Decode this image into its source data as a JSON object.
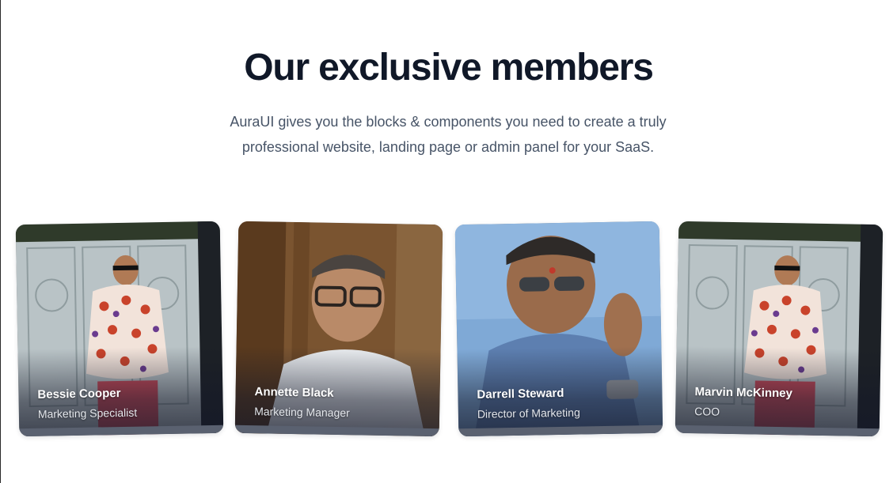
{
  "header": {
    "title": "Our exclusive members",
    "subtitle": "AuraUI gives you the blocks & components you need to create a truly professional website, landing page or admin panel for your SaaS."
  },
  "members": [
    {
      "name": "Bessie Cooper",
      "role": "Marketing Specialist"
    },
    {
      "name": "Annette Black",
      "role": "Marketing Manager"
    },
    {
      "name": "Darrell Steward",
      "role": "Director of Marketing"
    },
    {
      "name": "Marvin McKinney",
      "role": "COO"
    }
  ],
  "colors": {
    "title": "#101828",
    "body_text": "#475467",
    "card_name": "#ffffff",
    "card_role": "#e4e7ec"
  }
}
